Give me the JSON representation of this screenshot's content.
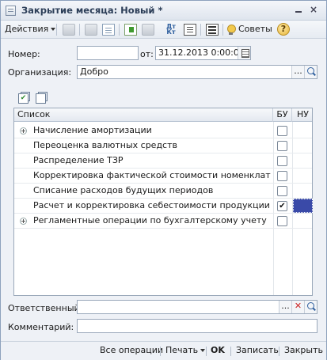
{
  "window": {
    "title": "Закрытие месяца: Новый *"
  },
  "toolbar": {
    "actions_label": "Действия",
    "advice_label": "Советы",
    "help_label": "?",
    "dtkt_top": "Дт",
    "dtkt_bottom": "Кт"
  },
  "form": {
    "number_label": "Номер:",
    "number_value": "",
    "date_label": "от:",
    "date_value": "31.12.2013  0:00:00",
    "org_label": "Организация:",
    "org_value": "Добро",
    "select_btn": "...",
    "responsible_label": "Ответственный:",
    "responsible_value": "",
    "clear_btn": "✕",
    "comment_label": "Комментарий:",
    "comment_value": ""
  },
  "table": {
    "col_list": "Список",
    "col_bu": "БУ",
    "col_nu": "НУ",
    "rows": [
      {
        "name": "Начисление амортизации",
        "expandable": true,
        "bu": false
      },
      {
        "name": "Переоценка валютных средств",
        "expandable": false,
        "bu": false
      },
      {
        "name": "Распределение ТЗР",
        "expandable": false,
        "bu": false
      },
      {
        "name": "Корректировка фактической стоимости номенклатуры",
        "expandable": false,
        "bu": false
      },
      {
        "name": "Списание расходов будущих периодов",
        "expandable": false,
        "bu": false
      },
      {
        "name": "Расчет и корректировка себестоимости продукции (услуг)",
        "expandable": false,
        "bu": true,
        "nu_selected": true
      },
      {
        "name": "Регламентные операции по бухгалтерскому учету",
        "expandable": true,
        "bu": false
      }
    ]
  },
  "footer": {
    "all_operations": "Все операции",
    "print": "Печать",
    "ok": "OK",
    "save": "Записать",
    "close": "Закрыть"
  },
  "colors": {
    "selected_cell": "#3a4aa8",
    "title_text": "#2c3e58"
  }
}
